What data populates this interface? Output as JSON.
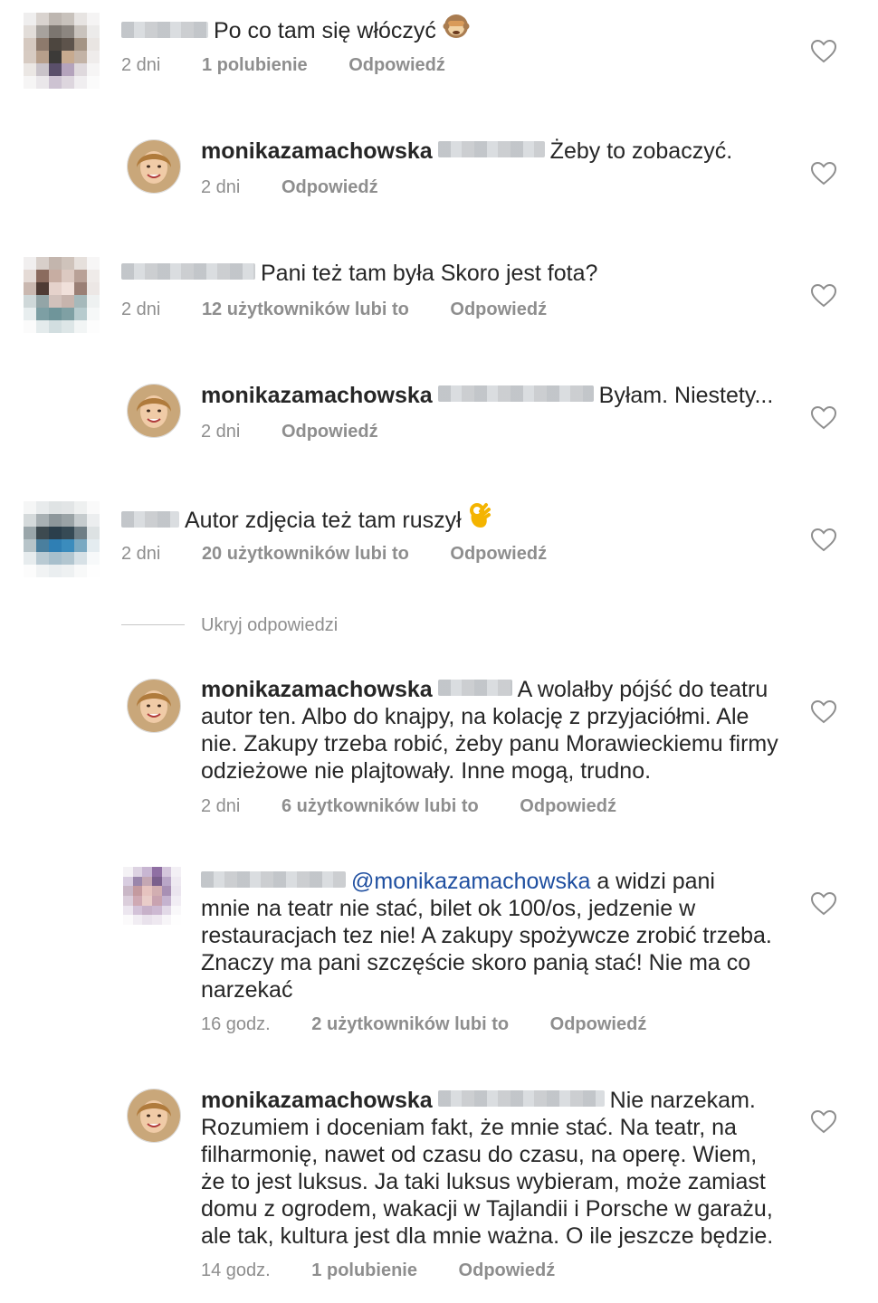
{
  "comments": [
    {
      "id": "c1",
      "user_blurred": true,
      "text": "Po co tam się włóczyć",
      "time": "2 dni",
      "likes": "1 polubienie",
      "reply": "Odpowiedź",
      "emoji": "see-no-evil-monkey"
    },
    {
      "id": "c2",
      "username": "monikazamachowska",
      "text": "Żeby to zobaczyć.",
      "time": "2 dni",
      "reply": "Odpowiedź"
    },
    {
      "id": "c3",
      "user_blurred": true,
      "text": "Pani też tam była Skoro jest fota?",
      "time": "2 dni",
      "likes": "12 użytkowników lubi to",
      "reply": "Odpowiedź"
    },
    {
      "id": "c4",
      "username": "monikazamachowska",
      "text": "Byłam. Niestety...",
      "time": "2 dni",
      "reply": "Odpowiedź"
    },
    {
      "id": "c5",
      "user_blurred": true,
      "text": "Autor zdjęcia też tam ruszył",
      "time": "2 dni",
      "likes": "20 użytkowników lubi to",
      "reply": "Odpowiedź",
      "emoji": "ok-hand"
    },
    {
      "id": "c6",
      "username": "monikazamachowska",
      "text_line1": "A wolałby pójść do teatru",
      "text_line2": "autor ten. Albo do knajpy, na kolację z przyjaciółmi. Ale",
      "text_line3": "nie. Zakupy trzeba robić, żeby panu Morawieckiemu firmy",
      "text_line4": "odzieżowe nie plajtowały. Inne mogą, trudno.",
      "time": "2 dni",
      "likes": "6 użytkowników lubi to",
      "reply": "Odpowiedź"
    },
    {
      "id": "c7",
      "user_blurred": true,
      "mention": "@monikazamachowska",
      "text_line1": "a widzi pani",
      "text_line2": "mnie na teatr nie stać, bilet ok 100/os, jedzenie w",
      "text_line3": "restauracjach tez nie! A zakupy spożywcze zrobić trzeba.",
      "text_line4": "Znaczy ma pani szczęście skoro panią stać! Nie ma co",
      "text_line5": "narzekać",
      "time": "16 godz.",
      "likes": "2 użytkowników lubi to",
      "reply": "Odpowiedź"
    },
    {
      "id": "c8",
      "username": "monikazamachowska",
      "text_line1": "Nie narzekam.",
      "text_line2": "Rozumiem i doceniam fakt, że mnie stać. Na teatr, na",
      "text_line3": "filharmonię, nawet od czasu do czasu, na operę. Wiem,",
      "text_line4": "że to jest luksus. Ja taki luksus wybieram, może zamiast",
      "text_line5": "domu z ogrodem, wakacji w Tajlandii i Porsche w garażu,",
      "text_line6": "ale tak, kultura jest dla mnie ważna. O ile jeszcze będzie.",
      "time": "14 godz.",
      "likes": "1 polubienie",
      "reply": "Odpowiedź"
    }
  ],
  "hide_replies": "Ukryj odpowiedzi",
  "colors": {
    "meta": "#8e8e8e",
    "text": "#262626",
    "mention": "#1f4fa0",
    "heart": "#8e8e8e"
  },
  "icons": {
    "like": "heart-outline-icon"
  }
}
